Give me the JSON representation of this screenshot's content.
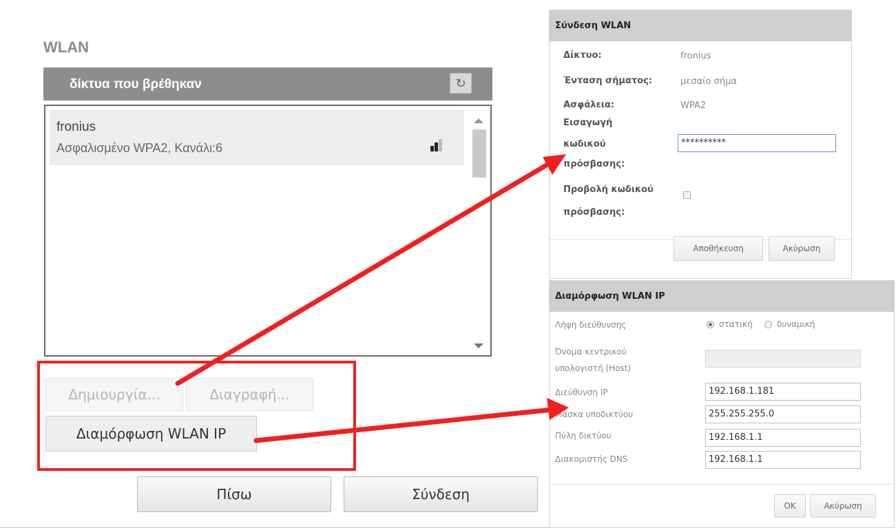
{
  "main": {
    "title": "WLAN",
    "list_header": "δίκτυα που βρέθηκαν",
    "networks": [
      {
        "name": "fronius",
        "description": "Ασφαλισμένο WPA2, Κανάλι:6",
        "signal_icon": "signal-strength-icon"
      }
    ],
    "buttons": {
      "create": "Δημιουργία...",
      "delete": "Διαγραφή...",
      "wlan_ip": "Διαμόρφωση WLAN IP",
      "back": "Πίσω",
      "connect": "Σύνδεση"
    },
    "refresh_icon": "refresh-icon"
  },
  "connect_dialog": {
    "title": "Σύνδεση WLAN",
    "network_label": "Δίκτυο:",
    "network_value": "fronius",
    "signal_label": "Ένταση σήματος:",
    "signal_value": "μεσαίο σήμα",
    "security_label": "Ασφάλεια:",
    "security_value": "WPA2",
    "password_label_1": "Εισαγωγή",
    "password_label_2": "κωδικού",
    "password_label_3": "πρόσβασης:",
    "password_value": "**********",
    "show_password_label_1": "Προβολή κωδικού",
    "show_password_label_2": "πρόσβασης:",
    "save": "Αποθήκευση",
    "cancel": "Ακύρωση"
  },
  "ip_dialog": {
    "title": "Διαμόρφωση WLAN IP",
    "address_mode_label": "Λήψη διεύθυνσης",
    "mode_static": "στατική",
    "mode_dynamic": "δυναμική",
    "hostname_label_1": "Όνομα κεντρικού",
    "hostname_label_2": "υπολογιστή (Host)",
    "hostname_value": "",
    "ip_label": "Διεύθυνση IP",
    "ip_value": "192.168.1.181",
    "mask_label": "Μάσκα υποδικτύου",
    "mask_value": "255.255.255.0",
    "gateway_label": "Πύλη δικτύου",
    "gateway_value": "192.168.1.1",
    "dns_label": "Διακομιστής DNS",
    "dns_value": "192.168.1.1",
    "ok": "OK",
    "cancel": "Ακύρωση"
  },
  "colors": {
    "header_bg": "#8d8d8d",
    "annotation_red": "#f02020",
    "dialog_title_bg": "#cfcfcf"
  }
}
